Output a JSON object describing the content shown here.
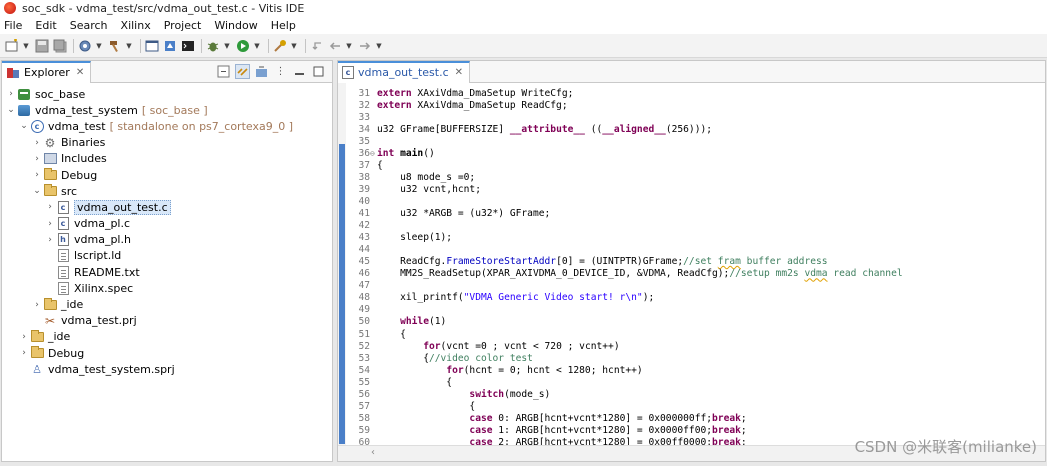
{
  "window": {
    "title": "soc_sdk - vdma_test/src/vdma_out_test.c - Vitis IDE"
  },
  "menu": [
    "File",
    "Edit",
    "Search",
    "Xilinx",
    "Project",
    "Window",
    "Help"
  ],
  "explorer": {
    "tab_label": "Explorer",
    "tab_close": "✕",
    "tree": [
      {
        "depth": 0,
        "twist": "›",
        "icon": "project-icon",
        "label": "soc_base",
        "decor": ""
      },
      {
        "depth": 0,
        "twist": "⌄",
        "icon": "system-project-icon",
        "label": "vdma_test_system",
        "decor": "[ soc_base ]"
      },
      {
        "depth": 1,
        "twist": "⌄",
        "icon": "application-icon",
        "label": "vdma_test",
        "decor": "[ standalone on ps7_cortexa9_0 ]"
      },
      {
        "depth": 2,
        "twist": "›",
        "icon": "binaries-icon",
        "label": "Binaries",
        "decor": ""
      },
      {
        "depth": 2,
        "twist": "›",
        "icon": "includes-icon",
        "label": "Includes",
        "decor": ""
      },
      {
        "depth": 2,
        "twist": "›",
        "icon": "folder-icon",
        "label": "Debug",
        "decor": ""
      },
      {
        "depth": 2,
        "twist": "⌄",
        "icon": "folder-icon",
        "label": "src",
        "decor": ""
      },
      {
        "depth": 3,
        "twist": "›",
        "icon": "c-file-icon",
        "label": "vdma_out_test.c",
        "decor": "",
        "selected": true
      },
      {
        "depth": 3,
        "twist": "›",
        "icon": "c-file-icon",
        "label": "vdma_pl.c",
        "decor": ""
      },
      {
        "depth": 3,
        "twist": "›",
        "icon": "h-file-icon",
        "label": "vdma_pl.h",
        "decor": ""
      },
      {
        "depth": 3,
        "twist": "",
        "icon": "file-icon",
        "label": "lscript.ld",
        "decor": ""
      },
      {
        "depth": 3,
        "twist": "",
        "icon": "file-icon",
        "label": "README.txt",
        "decor": ""
      },
      {
        "depth": 3,
        "twist": "",
        "icon": "file-icon",
        "label": "Xilinx.spec",
        "decor": ""
      },
      {
        "depth": 2,
        "twist": "›",
        "icon": "folder-icon",
        "label": "_ide",
        "decor": ""
      },
      {
        "depth": 2,
        "twist": "",
        "icon": "prj-file-icon",
        "label": "vdma_test.prj",
        "decor": ""
      },
      {
        "depth": 1,
        "twist": "›",
        "icon": "folder-icon",
        "label": "_ide",
        "decor": ""
      },
      {
        "depth": 1,
        "twist": "›",
        "icon": "folder-icon",
        "label": "Debug",
        "decor": ""
      },
      {
        "depth": 1,
        "twist": "",
        "icon": "sprj-file-icon",
        "label": "vdma_test_system.sprj",
        "decor": ""
      }
    ]
  },
  "editor": {
    "tab_label": "vdma_out_test.c",
    "tab_close": "✕",
    "lines": [
      {
        "n": "31",
        "html": [
          [
            "kw",
            "extern"
          ],
          [
            "code",
            " XAxiVdma_DmaSetup WriteCfg;"
          ]
        ]
      },
      {
        "n": "32",
        "html": [
          [
            "kw",
            "extern"
          ],
          [
            "code",
            " XAxiVdma_DmaSetup ReadCfg;"
          ]
        ]
      },
      {
        "n": "33",
        "html": []
      },
      {
        "n": "34",
        "html": [
          [
            "code",
            "u32 GFrame[BUFFERSIZE] "
          ],
          [
            "kw",
            "__attribute__"
          ],
          [
            "code",
            " (("
          ],
          [
            "kw",
            "__aligned__"
          ],
          [
            "code",
            "(256)));"
          ]
        ]
      },
      {
        "n": "35",
        "html": []
      },
      {
        "n": "36",
        "fold": "⊖",
        "html": [
          [
            "kw",
            "int"
          ],
          [
            "code",
            " "
          ],
          [
            "fn",
            "main"
          ],
          [
            "code",
            "()"
          ]
        ]
      },
      {
        "n": "37",
        "html": [
          [
            "code",
            "{"
          ]
        ]
      },
      {
        "n": "38",
        "html": [
          [
            "code",
            "    u8 mode_s =0;"
          ]
        ]
      },
      {
        "n": "39",
        "html": [
          [
            "code",
            "    u32 vcnt,hcnt;"
          ]
        ]
      },
      {
        "n": "40",
        "html": []
      },
      {
        "n": "41",
        "html": [
          [
            "code",
            "    u32 *ARGB = (u32*) GFrame;"
          ]
        ]
      },
      {
        "n": "42",
        "html": []
      },
      {
        "n": "43",
        "html": [
          [
            "code",
            "    sleep(1);"
          ]
        ]
      },
      {
        "n": "44",
        "html": []
      },
      {
        "n": "45",
        "html": [
          [
            "code",
            "    ReadCfg."
          ],
          [
            "field",
            "FrameStoreStartAddr"
          ],
          [
            "code",
            "[0] = (UINTPTR)GFrame;"
          ],
          [
            "comment",
            "//set "
          ],
          [
            "comment squiggle",
            "fram"
          ],
          [
            "comment",
            " buffer address"
          ]
        ]
      },
      {
        "n": "46",
        "html": [
          [
            "code",
            "    MM2S_ReadSetup(XPAR_AXIVDMA_0_DEVICE_ID, &VDMA, ReadCfg);"
          ],
          [
            "comment",
            "//setup mm2s "
          ],
          [
            "comment squiggle",
            "vdma"
          ],
          [
            "comment",
            " read channel"
          ]
        ]
      },
      {
        "n": "47",
        "html": []
      },
      {
        "n": "48",
        "html": [
          [
            "code",
            "    xil_printf("
          ],
          [
            "str",
            "\"VDMA Generic Video start! r\\n\""
          ],
          [
            "code",
            ");"
          ]
        ]
      },
      {
        "n": "49",
        "html": []
      },
      {
        "n": "50",
        "html": [
          [
            "code",
            "    "
          ],
          [
            "kw",
            "while"
          ],
          [
            "code",
            "(1)"
          ]
        ]
      },
      {
        "n": "51",
        "html": [
          [
            "code",
            "    {"
          ]
        ]
      },
      {
        "n": "52",
        "html": [
          [
            "code",
            "        "
          ],
          [
            "kw",
            "for"
          ],
          [
            "code",
            "(vcnt =0 ; vcnt < 720 ; vcnt++)"
          ]
        ]
      },
      {
        "n": "53",
        "html": [
          [
            "code",
            "        {"
          ],
          [
            "comment",
            "//video color test"
          ]
        ]
      },
      {
        "n": "54",
        "html": [
          [
            "code",
            "            "
          ],
          [
            "kw",
            "for"
          ],
          [
            "code",
            "(hcnt = 0; hcnt < 1280; hcnt++)"
          ]
        ]
      },
      {
        "n": "55",
        "html": [
          [
            "code",
            "            {"
          ]
        ]
      },
      {
        "n": "56",
        "html": [
          [
            "code",
            "                "
          ],
          [
            "kw",
            "switch"
          ],
          [
            "code",
            "(mode_s)"
          ]
        ]
      },
      {
        "n": "57",
        "html": [
          [
            "code",
            "                {"
          ]
        ]
      },
      {
        "n": "58",
        "html": [
          [
            "code",
            "                "
          ],
          [
            "kw",
            "case"
          ],
          [
            "code",
            " 0: ARGB[hcnt+vcnt*1280] = 0x000000ff;"
          ],
          [
            "kw",
            "break"
          ],
          [
            "code",
            ";"
          ]
        ]
      },
      {
        "n": "59",
        "html": [
          [
            "code",
            "                "
          ],
          [
            "kw",
            "case"
          ],
          [
            "code",
            " 1: ARGB[hcnt+vcnt*1280] = 0x0000ff00;"
          ],
          [
            "kw",
            "break"
          ],
          [
            "code",
            ";"
          ]
        ]
      },
      {
        "n": "60",
        "html": [
          [
            "code",
            "                "
          ],
          [
            "kw",
            "case"
          ],
          [
            "code",
            " 2: ARGB[hcnt+vcnt*1280] = 0x00ff0000;"
          ],
          [
            "kw",
            "break"
          ],
          [
            "code",
            ";"
          ]
        ]
      }
    ]
  },
  "watermark": "CSDN @米联客(milianke)"
}
